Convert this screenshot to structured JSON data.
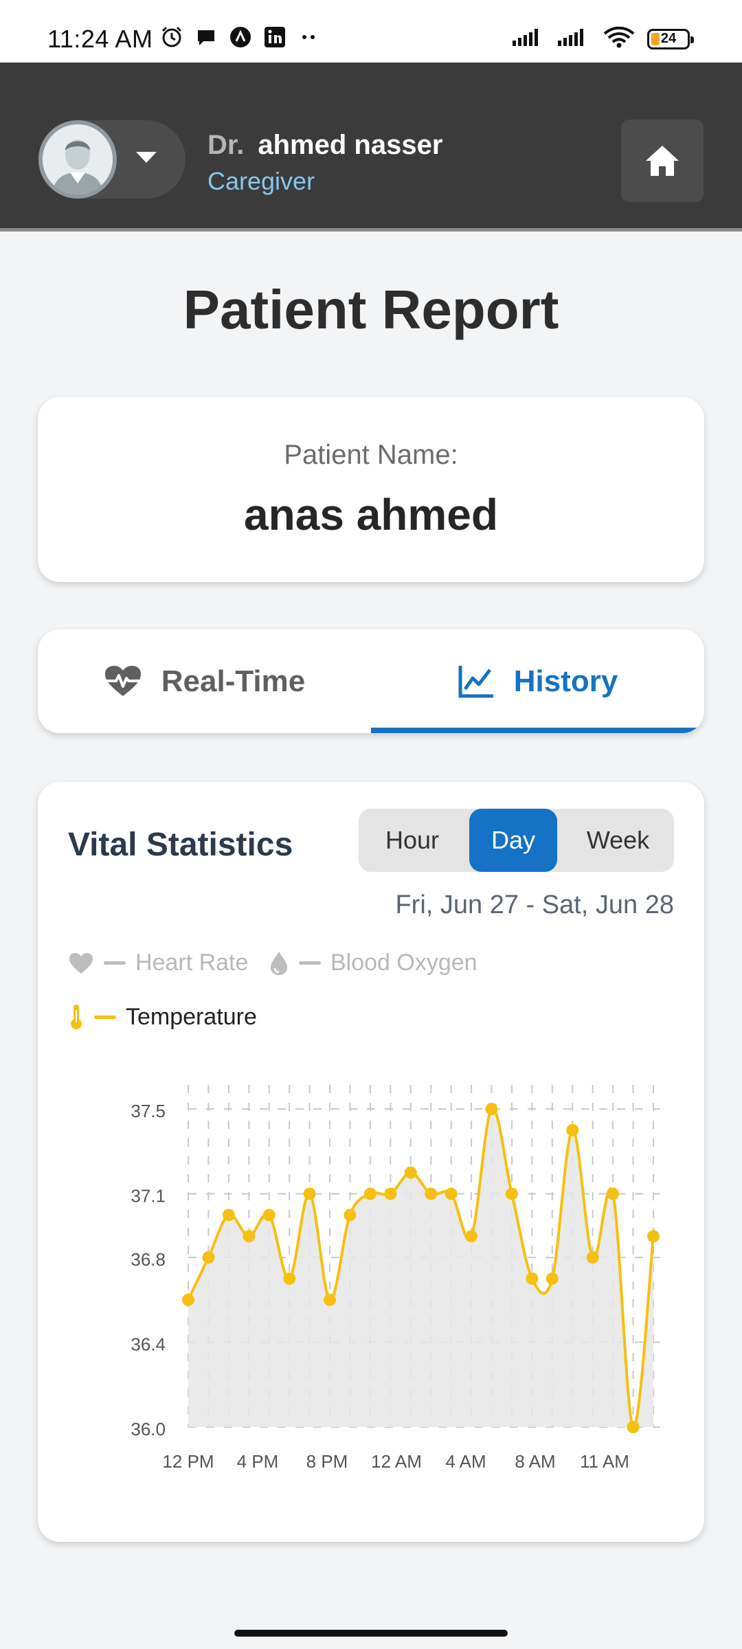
{
  "status_bar": {
    "time": "11:24 AM",
    "battery": "24",
    "icons": [
      "alarm-icon",
      "chat-icon",
      "app-icon",
      "linkedin-icon",
      "more-dots-icon",
      "signal-icon",
      "signal-icon",
      "wifi-icon",
      "battery-icon"
    ]
  },
  "header": {
    "doctor_prefix": "Dr.",
    "doctor_name": "ahmed nasser",
    "role": "Caregiver",
    "home_icon": "home-icon"
  },
  "page": {
    "title": "Patient Report"
  },
  "patient": {
    "label": "Patient Name:",
    "name": "anas ahmed"
  },
  "tabs": [
    {
      "label": "Real-Time",
      "icon": "heart-pulse-icon",
      "active": false
    },
    {
      "label": "History",
      "icon": "line-chart-icon",
      "active": true
    }
  ],
  "stats": {
    "title": "Vital Statistics",
    "ranges": [
      {
        "label": "Hour",
        "active": false
      },
      {
        "label": "Day",
        "active": true
      },
      {
        "label": "Week",
        "active": false
      }
    ],
    "date_range": "Fri, Jun 27 - Sat, Jun 28",
    "legend": [
      {
        "label": "Heart Rate",
        "icon": "heart-icon",
        "active": false,
        "color": "#bdbdbd"
      },
      {
        "label": "Blood Oxygen",
        "icon": "drop-icon",
        "active": false,
        "color": "#bdbdbd"
      },
      {
        "label": "Temperature",
        "icon": "thermometer-icon",
        "active": true,
        "color": "#f5c011"
      }
    ]
  },
  "chart_data": {
    "type": "area",
    "title": "",
    "xlabel": "",
    "ylabel": "",
    "ylim": [
      36.0,
      37.5
    ],
    "yticks": [
      "37.5",
      "37.1",
      "36.8",
      "36.4",
      "36.0"
    ],
    "xticks": [
      "12 PM",
      "4 PM",
      "8 PM",
      "12 AM",
      "4 AM",
      "8 AM",
      "11 AM"
    ],
    "grid": true,
    "series": [
      {
        "name": "Temperature",
        "color": "#f5c011",
        "fill": "#e6e6e6",
        "values": [
          36.6,
          36.8,
          37.0,
          36.9,
          37.0,
          36.7,
          37.1,
          36.6,
          37.0,
          37.1,
          37.1,
          37.2,
          37.1,
          37.1,
          36.9,
          37.5,
          37.1,
          36.7,
          36.7,
          37.4,
          36.8,
          37.1,
          36.0,
          36.9
        ]
      }
    ]
  }
}
